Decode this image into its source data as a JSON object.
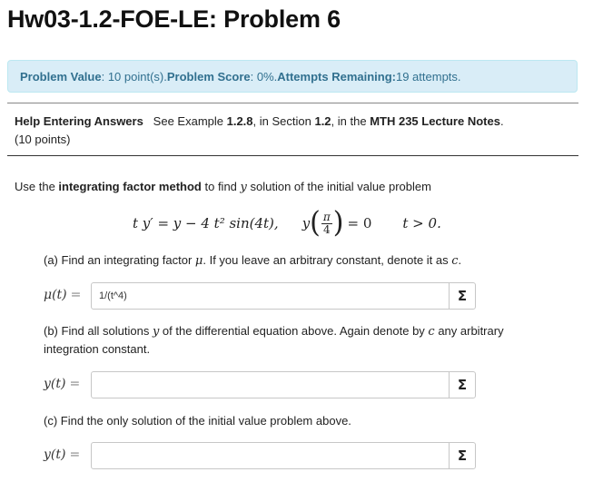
{
  "header": {
    "title": "Hw03-1.2-FOE-LE: Problem 6"
  },
  "info": {
    "value_label": "Problem Value",
    "value_text": ": 10 point(s). ",
    "score_label": "Problem Score",
    "score_text": ": 0%. ",
    "attempts_label": "Attempts Remaining:",
    "attempts_text": " 19 attempts."
  },
  "help": {
    "link": "Help Entering Answers",
    "text1": "See Example ",
    "example": "1.2.8",
    "text2": ", in Section ",
    "section": "1.2",
    "text3": ", in the ",
    "notes": "MTH 235 Lecture Notes",
    "text4": ".",
    "points": "(10 points)"
  },
  "problem": {
    "intro_a": "Use the ",
    "intro_bold": "integrating factor method",
    "intro_b": " to find ",
    "intro_var": "y",
    "intro_c": " solution of the initial value problem",
    "eq_lhs": "t y′ = y − 4 t² sin(4t),",
    "ic_y": "y",
    "ic_num": "π",
    "ic_den": "4",
    "ic_rhs": "= 0",
    "cond": "t > 0."
  },
  "part_a": {
    "text1": "(a) Find an integrating factor ",
    "mu": "μ",
    "text2": ". If you leave an arbitrary constant, denote it as ",
    "c": "c",
    "text3": ".",
    "label": "μ(t)",
    "eq": "=",
    "answer": "1/(t^4)",
    "sigma": "Σ"
  },
  "part_b": {
    "text1": "(b) Find all solutions ",
    "y": "y",
    "text2": " of the differential equation above. Again denote by ",
    "c": "c",
    "text3": " any arbitrary integration constant.",
    "label": "y(t)",
    "eq": "=",
    "answer": "",
    "sigma": "Σ"
  },
  "part_c": {
    "text": "(c) Find the only solution of the initial value problem above.",
    "label": "y(t)",
    "eq": "=",
    "answer": "",
    "sigma": "Σ"
  }
}
